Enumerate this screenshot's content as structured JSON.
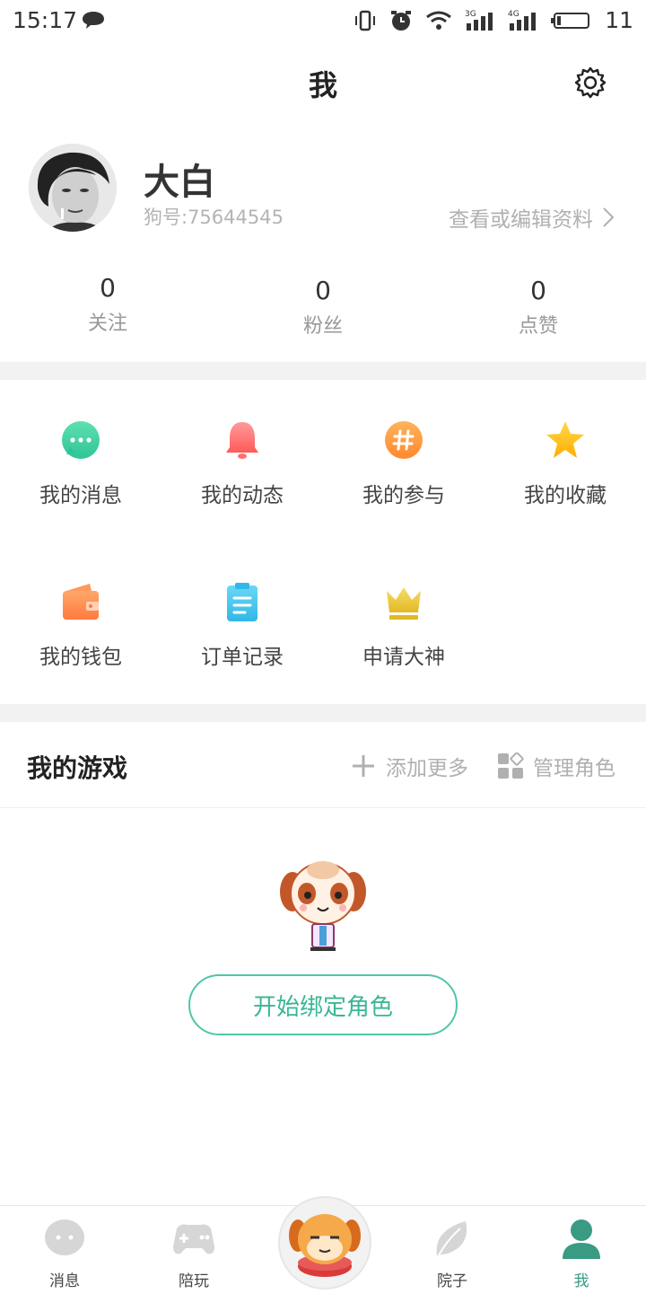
{
  "status_bar": {
    "time": "15:17",
    "battery": "11"
  },
  "header": {
    "title": "我"
  },
  "profile": {
    "name": "大白",
    "id_text": "狗号:75644545",
    "edit_label": "查看或编辑资料"
  },
  "stats": [
    {
      "value": "0",
      "label": "关注"
    },
    {
      "value": "0",
      "label": "粉丝"
    },
    {
      "value": "0",
      "label": "点赞"
    }
  ],
  "features": [
    {
      "label": "我的消息",
      "icon": "message-icon",
      "color": "#3ccf9c"
    },
    {
      "label": "我的动态",
      "icon": "bell-icon",
      "color": "#ff6f6f"
    },
    {
      "label": "我的参与",
      "icon": "hashtag-icon",
      "color": "#ff9a3c"
    },
    {
      "label": "我的收藏",
      "icon": "star-icon",
      "color": "#ffc21a"
    },
    {
      "label": "我的钱包",
      "icon": "wallet-icon",
      "color": "#ff8a50"
    },
    {
      "label": "订单记录",
      "icon": "clipboard-icon",
      "color": "#3cc0e8"
    },
    {
      "label": "申请大神",
      "icon": "crown-icon",
      "color": "#e9c23a"
    }
  ],
  "games": {
    "title": "我的游戏",
    "add_label": "添加更多",
    "manage_label": "管理角色",
    "bind_label": "开始绑定角色"
  },
  "tabbar": [
    {
      "label": "消息",
      "icon": "chat-bubble-icon"
    },
    {
      "label": "陪玩",
      "icon": "gamepad-icon"
    },
    {
      "label": "",
      "icon": "dog-mascot-icon"
    },
    {
      "label": "院子",
      "icon": "leaf-icon"
    },
    {
      "label": "我",
      "icon": "person-icon",
      "active": true
    }
  ],
  "colors": {
    "accent": "#3ab696",
    "tab_active": "#3a9a84",
    "tab_inactive": "#d6d6d6"
  }
}
